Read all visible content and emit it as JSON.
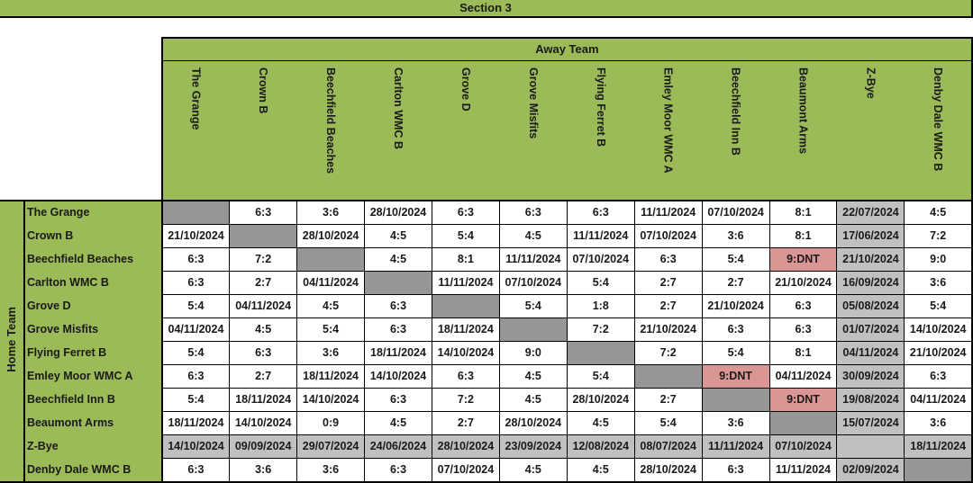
{
  "title": "Section 3",
  "away_label": "Away Team",
  "home_label": "Home Team",
  "colors": {
    "header_green": "#9bbb59",
    "self_match_grey": "#969696",
    "bye_grey": "#c0c0c0",
    "did_not_travel_red": "#da9694"
  },
  "teams": [
    "The Grange",
    "Crown B",
    "Beechfield Beaches",
    "Carlton WMC B",
    "Grove D",
    "Grove Misfits",
    "Flying Ferret B",
    "Emley Moor WMC A",
    "Beechfield Inn B",
    "Beaumont Arms",
    "Z-Bye",
    "Denby Dale WMC B"
  ],
  "rows": [
    {
      "home": "The Grange",
      "cells": [
        "",
        "6:3",
        "3:6",
        "28/10/2024",
        "6:3",
        "6:3",
        "6:3",
        "11/11/2024",
        "07/10/2024",
        "8:1",
        "22/07/2024",
        "4:5"
      ]
    },
    {
      "home": "Crown B",
      "cells": [
        "21/10/2024",
        "",
        "28/10/2024",
        "4:5",
        "5:4",
        "4:5",
        "11/11/2024",
        "07/10/2024",
        "3:6",
        "8:1",
        "17/06/2024",
        "7:2"
      ]
    },
    {
      "home": "Beechfield Beaches",
      "cells": [
        "6:3",
        "7:2",
        "",
        "4:5",
        "8:1",
        "11/11/2024",
        "07/10/2024",
        "6:3",
        "5:4",
        "9:DNT",
        "21/10/2024",
        "9:0"
      ]
    },
    {
      "home": "Carlton WMC B",
      "cells": [
        "6:3",
        "2:7",
        "04/11/2024",
        "",
        "11/11/2024",
        "07/10/2024",
        "5:4",
        "2:7",
        "2:7",
        "21/10/2024",
        "16/09/2024",
        "3:6"
      ]
    },
    {
      "home": "Grove D",
      "cells": [
        "5:4",
        "04/11/2024",
        "4:5",
        "6:3",
        "",
        "5:4",
        "1:8",
        "2:7",
        "21/10/2024",
        "6:3",
        "05/08/2024",
        "5:4"
      ]
    },
    {
      "home": "Grove Misfits",
      "cells": [
        "04/11/2024",
        "4:5",
        "5:4",
        "6:3",
        "18/11/2024",
        "",
        "7:2",
        "21/10/2024",
        "6:3",
        "6:3",
        "01/07/2024",
        "14/10/2024"
      ]
    },
    {
      "home": "Flying Ferret B",
      "cells": [
        "5:4",
        "6:3",
        "3:6",
        "18/11/2024",
        "14/10/2024",
        "9:0",
        "",
        "7:2",
        "5:4",
        "8:1",
        "04/11/2024",
        "21/10/2024"
      ]
    },
    {
      "home": "Emley Moor WMC A",
      "cells": [
        "6:3",
        "2:7",
        "18/11/2024",
        "14/10/2024",
        "6:3",
        "4:5",
        "5:4",
        "",
        "9:DNT",
        "04/11/2024",
        "30/09/2024",
        "6:3"
      ]
    },
    {
      "home": "Beechfield Inn B",
      "cells": [
        "5:4",
        "18/11/2024",
        "14/10/2024",
        "6:3",
        "7:2",
        "4:5",
        "28/10/2024",
        "2:7",
        "",
        "9:DNT",
        "19/08/2024",
        "04/11/2024"
      ]
    },
    {
      "home": "Beaumont Arms",
      "cells": [
        "18/11/2024",
        "14/10/2024",
        "0:9",
        "4:5",
        "2:7",
        "28/10/2024",
        "4:5",
        "5:4",
        "3:6",
        "",
        "15/07/2024",
        "3:6"
      ]
    },
    {
      "home": "Z-Bye",
      "cells": [
        "14/10/2024",
        "09/09/2024",
        "29/07/2024",
        "24/06/2024",
        "28/10/2024",
        "23/09/2024",
        "12/08/2024",
        "08/07/2024",
        "11/11/2024",
        "07/10/2024",
        "",
        "18/11/2024"
      ]
    },
    {
      "home": "Denby Dale WMC B",
      "cells": [
        "6:3",
        "3:6",
        "3:6",
        "6:3",
        "07/10/2024",
        "4:5",
        "4:5",
        "28/10/2024",
        "6:3",
        "11/11/2024",
        "02/09/2024",
        ""
      ]
    }
  ]
}
